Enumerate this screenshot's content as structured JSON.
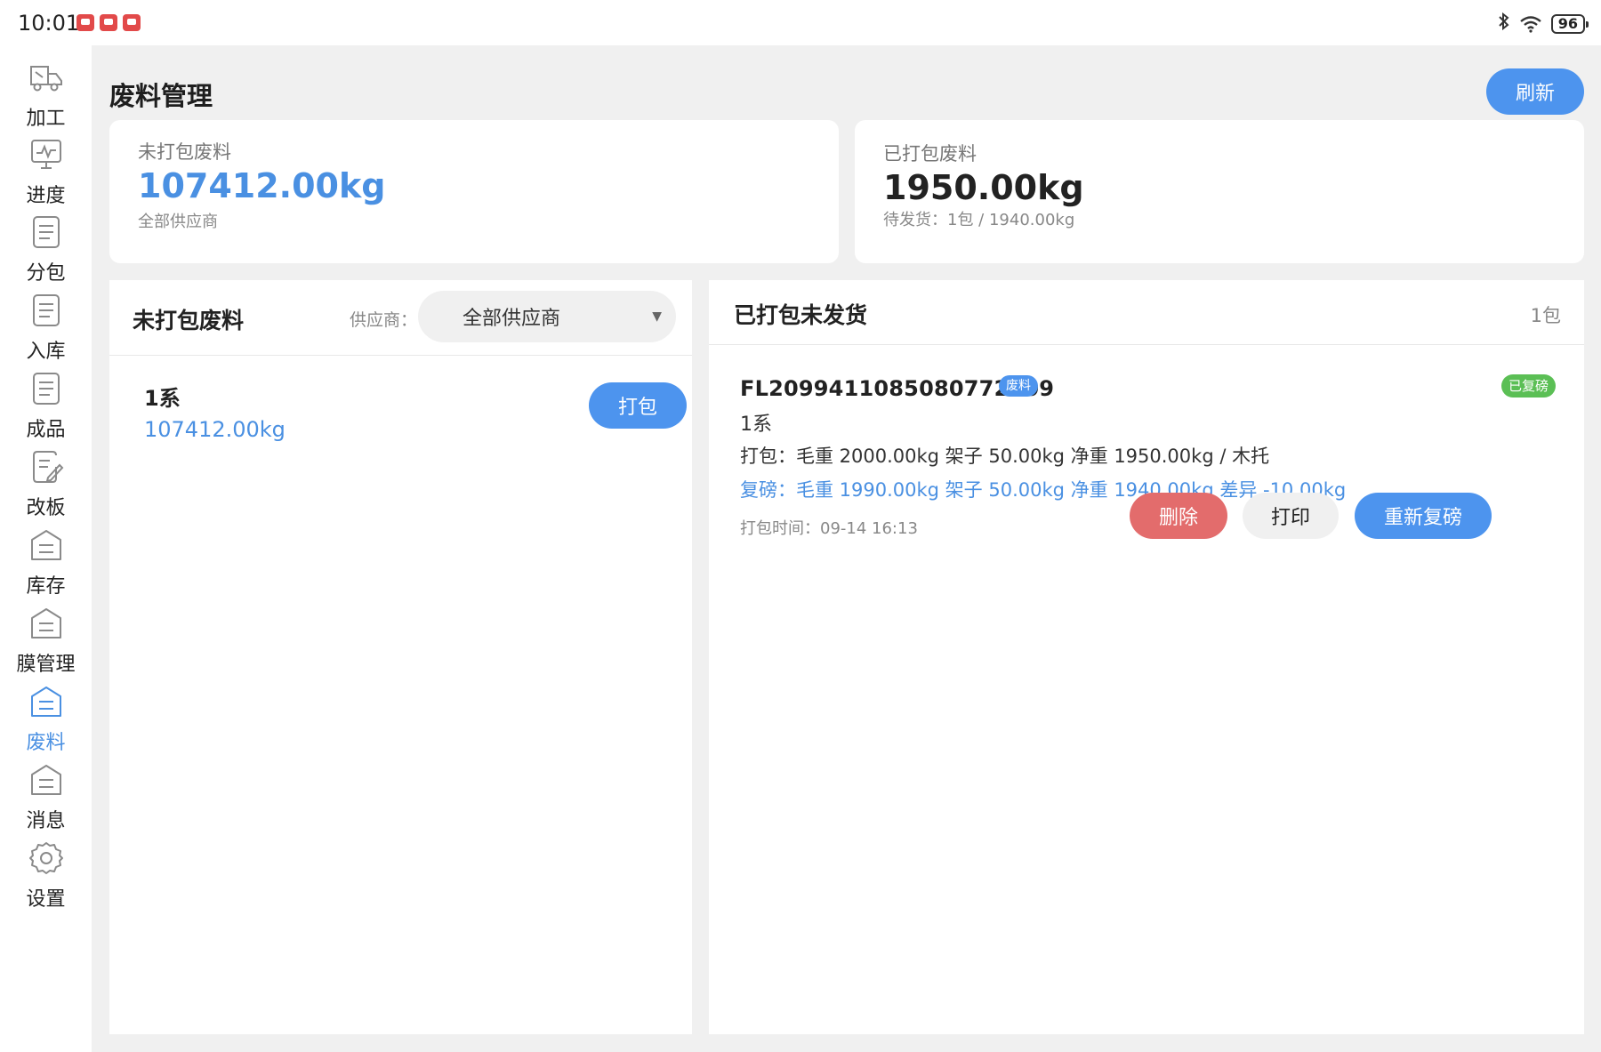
{
  "status_bar": {
    "time": "10:01",
    "battery": "96"
  },
  "sidebar": {
    "items": [
      {
        "label": "加工",
        "icon": "truck-icon"
      },
      {
        "label": "进度",
        "icon": "monitor-chart-icon"
      },
      {
        "label": "分包",
        "icon": "document-icon"
      },
      {
        "label": "入库",
        "icon": "document-icon"
      },
      {
        "label": "成品",
        "icon": "document-icon"
      },
      {
        "label": "改板",
        "icon": "edit-document-icon"
      },
      {
        "label": "库存",
        "icon": "warehouse-icon"
      },
      {
        "label": "膜管理",
        "icon": "warehouse-icon"
      },
      {
        "label": "废料",
        "icon": "warehouse-icon",
        "active": true
      },
      {
        "label": "消息",
        "icon": "warehouse-icon"
      },
      {
        "label": "设置",
        "icon": "gear-icon"
      }
    ],
    "active_color": "#4a90e2"
  },
  "header": {
    "title": "废料管理",
    "refresh_label": "刷新"
  },
  "summary": {
    "unpacked": {
      "label": "未打包废料",
      "value": "107412.00kg",
      "sub": "全部供应商"
    },
    "packed": {
      "label": "已打包废料",
      "value": "1950.00kg",
      "sub": "待发货：1包 / 1940.00kg"
    }
  },
  "unpacked_panel": {
    "title": "未打包废料",
    "supplier_label": "供应商：",
    "supplier_selected": "全部供应商",
    "items": [
      {
        "name": "1系",
        "weight": "107412.00kg",
        "action_label": "打包"
      }
    ]
  },
  "packed_panel": {
    "title": "已打包未发货",
    "count": "1包",
    "packages": [
      {
        "code": "FL2099411085080772609",
        "type_tag": "废料",
        "status_tag": "已复磅",
        "series": "1系",
        "pack_line": "打包：毛重 2000.00kg  架子 50.00kg  净重 1950.00kg  / 木托",
        "reweigh_line": "复磅：毛重 1990.00kg  架子 50.00kg  净重 1940.00kg  差异 -10.00kg",
        "pack_time": "打包时间：09-14 16:13",
        "delete_label": "删除",
        "print_label": "打印",
        "reweigh_label": "重新复磅"
      }
    ]
  },
  "colors": {
    "accent": "#4d94ee",
    "danger": "#e36c6c",
    "success": "#5bbf55",
    "background": "#f0f0f0"
  }
}
